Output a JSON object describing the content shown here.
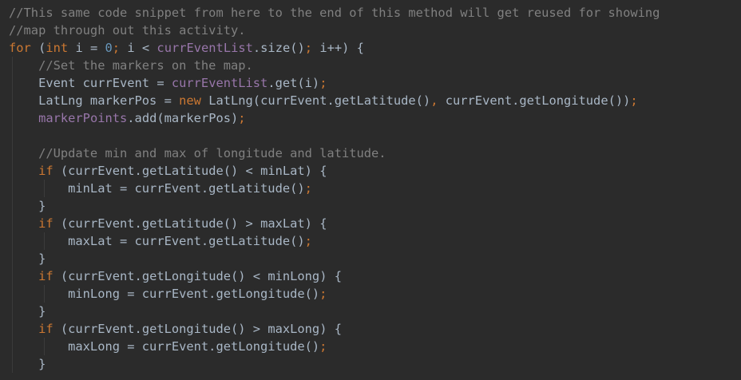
{
  "editor": {
    "lines": [
      [
        {
          "t": "//This same code snippet from here to the end of this method will get reused for showing",
          "k": "comment"
        }
      ],
      [
        {
          "t": "//map through out this activity.",
          "k": "comment"
        }
      ],
      [
        {
          "t": "for",
          "k": "keyword"
        },
        {
          "t": " (",
          "k": "plain"
        },
        {
          "t": "int",
          "k": "keyword"
        },
        {
          "t": " i = ",
          "k": "plain"
        },
        {
          "t": "0",
          "k": "number"
        },
        {
          "t": "; ",
          "k": "punct"
        },
        {
          "t": "i < ",
          "k": "plain"
        },
        {
          "t": "currEventList",
          "k": "field"
        },
        {
          "t": ".size()",
          "k": "plain"
        },
        {
          "t": "; ",
          "k": "punct"
        },
        {
          "t": "i++) {",
          "k": "plain"
        }
      ],
      [
        {
          "t": "    //Set the markers on the map.",
          "k": "comment"
        }
      ],
      [
        {
          "t": "    Event currEvent = ",
          "k": "plain"
        },
        {
          "t": "currEventList",
          "k": "field"
        },
        {
          "t": ".get(i)",
          "k": "plain"
        },
        {
          "t": ";",
          "k": "punct"
        }
      ],
      [
        {
          "t": "    LatLng markerPos = ",
          "k": "plain"
        },
        {
          "t": "new",
          "k": "keyword"
        },
        {
          "t": " LatLng(currEvent.getLatitude()",
          "k": "plain"
        },
        {
          "t": ", ",
          "k": "punct"
        },
        {
          "t": "currEvent.getLongitude())",
          "k": "plain"
        },
        {
          "t": ";",
          "k": "punct"
        }
      ],
      [
        {
          "t": "    ",
          "k": "plain"
        },
        {
          "t": "markerPoints",
          "k": "field"
        },
        {
          "t": ".add(markerPos)",
          "k": "plain"
        },
        {
          "t": ";",
          "k": "punct"
        }
      ],
      [
        {
          "t": "",
          "k": "plain"
        }
      ],
      [
        {
          "t": "    //Update min and max of longitude and latitude.",
          "k": "comment"
        }
      ],
      [
        {
          "t": "    ",
          "k": "plain"
        },
        {
          "t": "if",
          "k": "keyword"
        },
        {
          "t": " (currEvent.getLatitude() < minLat) {",
          "k": "plain"
        }
      ],
      [
        {
          "t": "        minLat = currEvent.getLatitude()",
          "k": "plain"
        },
        {
          "t": ";",
          "k": "punct"
        }
      ],
      [
        {
          "t": "    }",
          "k": "plain"
        }
      ],
      [
        {
          "t": "    ",
          "k": "plain"
        },
        {
          "t": "if",
          "k": "keyword"
        },
        {
          "t": " (currEvent.getLatitude() > maxLat) {",
          "k": "plain"
        }
      ],
      [
        {
          "t": "        maxLat = currEvent.getLatitude()",
          "k": "plain"
        },
        {
          "t": ";",
          "k": "punct"
        }
      ],
      [
        {
          "t": "    }",
          "k": "plain"
        }
      ],
      [
        {
          "t": "    ",
          "k": "plain"
        },
        {
          "t": "if",
          "k": "keyword"
        },
        {
          "t": " (currEvent.getLongitude() < minLong) {",
          "k": "plain"
        }
      ],
      [
        {
          "t": "        minLong = currEvent.getLongitude()",
          "k": "plain"
        },
        {
          "t": ";",
          "k": "punct"
        }
      ],
      [
        {
          "t": "    }",
          "k": "plain"
        }
      ],
      [
        {
          "t": "    ",
          "k": "plain"
        },
        {
          "t": "if",
          "k": "keyword"
        },
        {
          "t": " (currEvent.getLongitude() > maxLong) {",
          "k": "plain"
        }
      ],
      [
        {
          "t": "        maxLong = currEvent.getLongitude()",
          "k": "plain"
        },
        {
          "t": ";",
          "k": "punct"
        }
      ],
      [
        {
          "t": "    }",
          "k": "plain"
        }
      ]
    ]
  },
  "theme": {
    "background": "#2b2b2b",
    "plain": "#a9b7c6",
    "comment": "#808080",
    "keyword": "#cc7832",
    "field": "#9876aa",
    "number": "#6897bb"
  }
}
